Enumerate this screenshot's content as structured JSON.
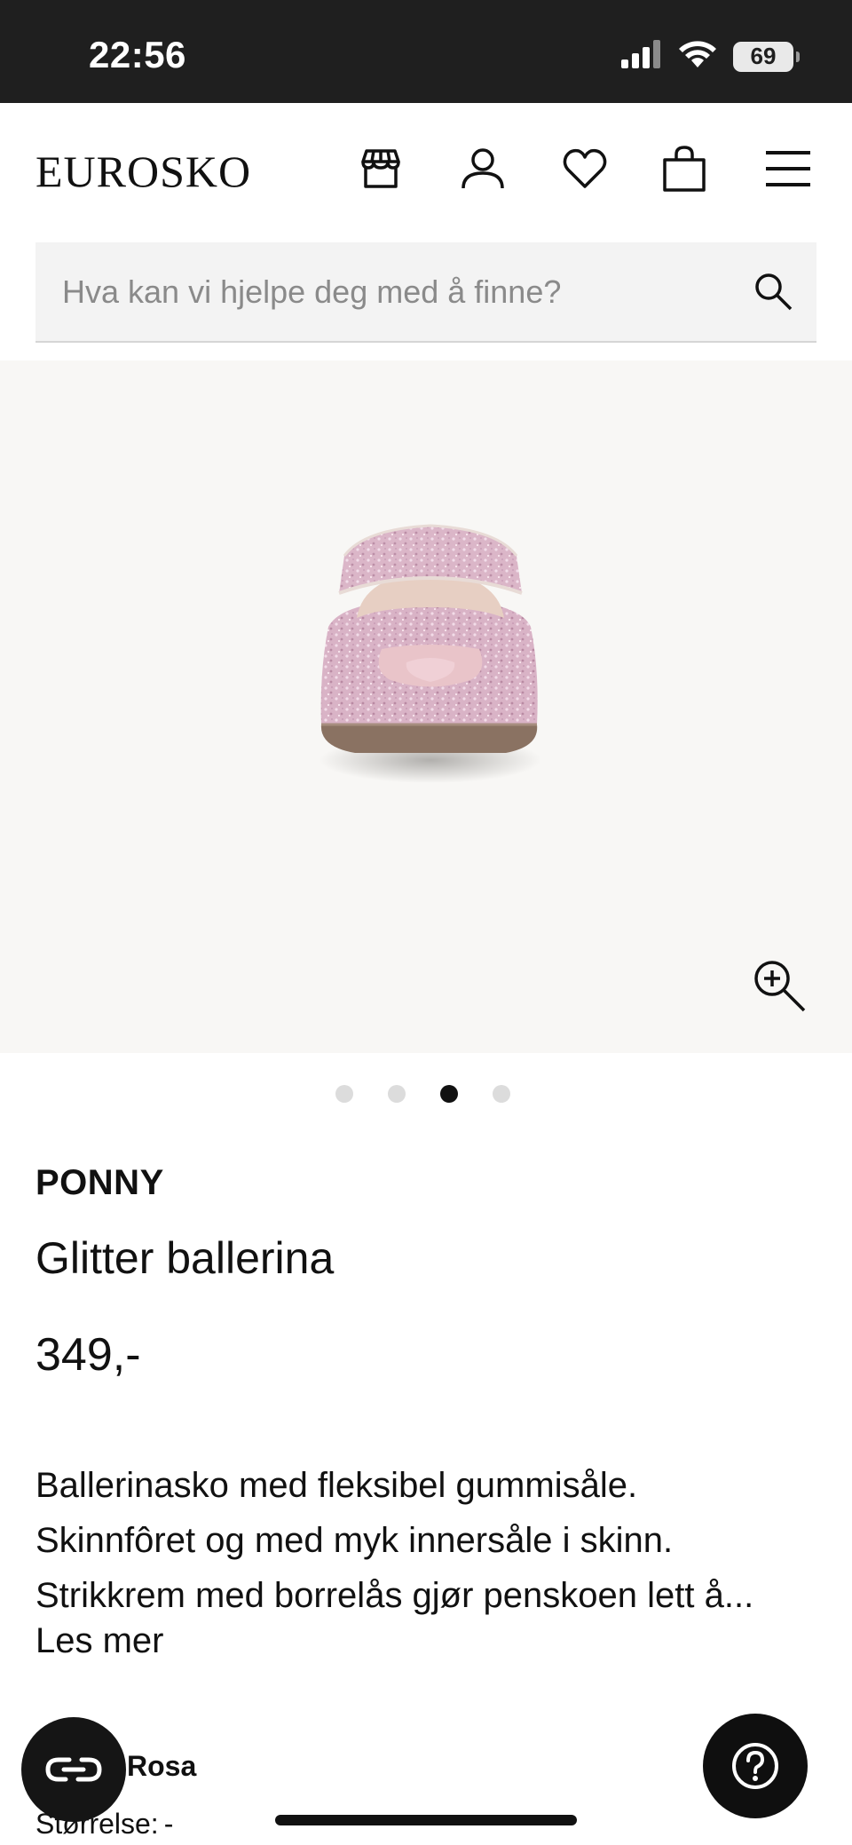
{
  "status_bar": {
    "time": "22:56",
    "battery": "69",
    "icons": [
      "signal-icon",
      "wifi-icon",
      "battery-icon"
    ]
  },
  "header": {
    "logo": "EUROSKO",
    "icons": [
      "store-icon",
      "user-icon",
      "heart-icon",
      "bag-icon",
      "menu-icon"
    ]
  },
  "search": {
    "placeholder": "Hva kan vi hjelpe deg med å finne?",
    "icon": "search-icon"
  },
  "carousel": {
    "dots": 4,
    "active_index": 2,
    "zoom_icon": "zoom-in-icon"
  },
  "product": {
    "brand": "PONNY",
    "name": "Glitter ballerina",
    "price": "349,-",
    "description_lines": [
      "Ballerinasko med fleksibel gummisåle.",
      "Skinnfôret og med myk innersåle i skinn.",
      "Strikkrem med borrelås gjør penskoen lett å..."
    ],
    "read_more": "Les mer",
    "color_value": "Rosa",
    "size_label": "Størrelse:",
    "size_value": "-"
  },
  "floating": {
    "left_icon": "link-icon",
    "right_icon": "help-icon"
  },
  "colors": {
    "status_bar_bg": "#1f1f1f",
    "search_bg": "#f3f3f3",
    "image_bg": "#f8f7f5",
    "active_dot": "#111111",
    "inactive_dot": "#dcdcdc"
  }
}
